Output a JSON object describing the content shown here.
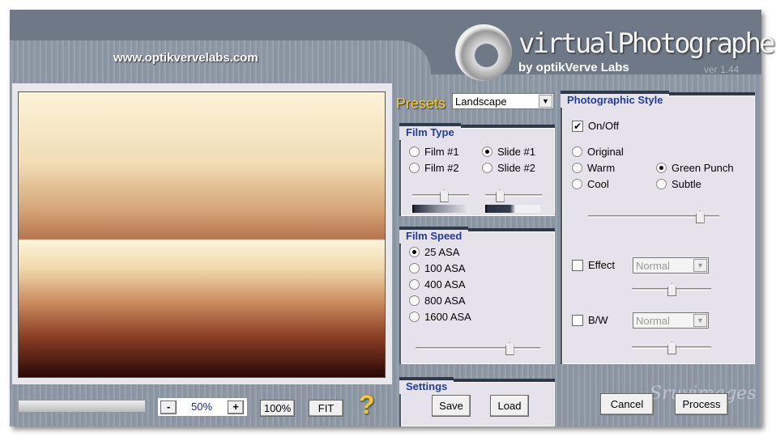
{
  "header": {
    "url": "www.optikvervelabs.com",
    "title": "virtualPhotographer",
    "byline": "by optikVerve Labs",
    "version": "ver 1.44"
  },
  "presets": {
    "label": "Presets",
    "value": "Landscape"
  },
  "film_type": {
    "title": "Film Type",
    "options": [
      {
        "label": "Film #1",
        "selected": false
      },
      {
        "label": "Film #2",
        "selected": false
      },
      {
        "label": "Slide #1",
        "selected": true
      },
      {
        "label": "Slide #2",
        "selected": false
      }
    ],
    "slider_film": 0.55,
    "slider_slide": 0.25
  },
  "film_speed": {
    "title": "Film Speed",
    "options": [
      {
        "label": "25 ASA",
        "selected": true
      },
      {
        "label": "100 ASA",
        "selected": false
      },
      {
        "label": "400 ASA",
        "selected": false
      },
      {
        "label": "800 ASA",
        "selected": false
      },
      {
        "label": "1600 ASA",
        "selected": false
      }
    ],
    "slider": 0.75
  },
  "style": {
    "title": "Photographic Style",
    "onoff_label": "On/Off",
    "onoff_checked": true,
    "options": [
      {
        "label": "Original",
        "selected": false
      },
      {
        "label": "Warm",
        "selected": false
      },
      {
        "label": "Cool",
        "selected": false
      },
      {
        "label": "Green Punch",
        "selected": true
      },
      {
        "label": "Subtle",
        "selected": false
      }
    ],
    "slider": 0.85,
    "effect": {
      "label": "Effect",
      "checked": false,
      "value": "Normal",
      "slider": 0.5
    },
    "bw": {
      "label": "B/W",
      "checked": false,
      "value": "Normal",
      "slider": 0.5
    }
  },
  "settings": {
    "title": "Settings",
    "save": "Save",
    "load": "Load"
  },
  "zoom": {
    "minus": "-",
    "value": "50%",
    "plus": "+",
    "actual": "100%",
    "fit": "FIT",
    "help": "?"
  },
  "actions": {
    "cancel": "Cancel",
    "process": "Process"
  },
  "watermark": "Sruvimages",
  "progress": 0
}
